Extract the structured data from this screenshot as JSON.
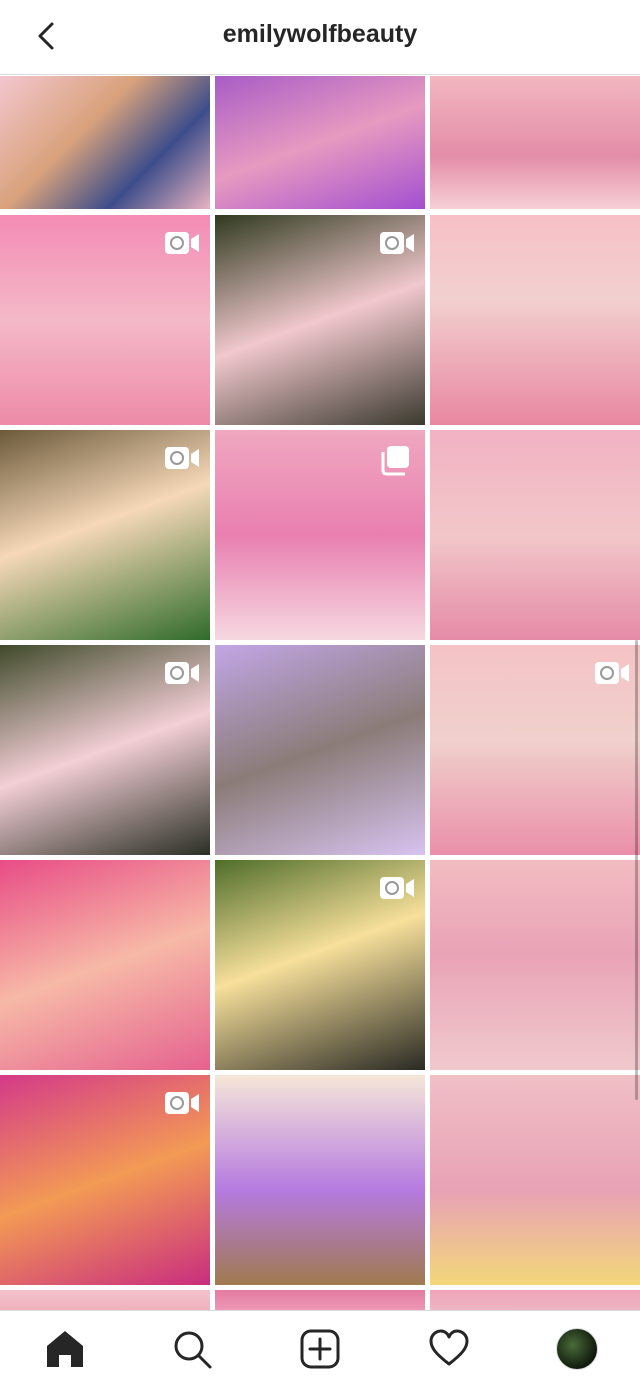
{
  "header": {
    "username": "emilywolfbeauty",
    "back_icon": "chevron-left-icon"
  },
  "grid": {
    "posts": [
      {
        "name": "post-makeup-flatlay",
        "bg": "linear-gradient(135deg,#f3c6cf,#d9a27c 40%,#3d4d8a 70%,#e9b3c2)",
        "badge": "none"
      },
      {
        "name": "post-puppy-pajamas",
        "bg": "linear-gradient(160deg,#a85cc6,#e79ac0 50%,#a34fd1)",
        "badge": "none"
      },
      {
        "name": "post-purple-lips",
        "bg": "linear-gradient(180deg,#f2b7c0,#e48da8 60%,#f7d0d6)",
        "badge": "none"
      },
      {
        "name": "post-pencil-mustache",
        "bg": "linear-gradient(180deg,#f48bb4,#f4b9c8 50%,#ee8aa8)",
        "badge": "video"
      },
      {
        "name": "post-axolotl-plants",
        "bg": "linear-gradient(160deg,#2f3a1f,#f1c8cd 50%,#3b3a2f)",
        "badge": "video"
      },
      {
        "name": "post-cupcake-lips",
        "bg": "linear-gradient(180deg,#f7c0c6,#f2d0cf 40%,#e987a1)",
        "badge": "none"
      },
      {
        "name": "post-axolotl-tophat",
        "bg": "linear-gradient(160deg,#6b5a3a,#f6d8b8 45%,#2f6b2a)",
        "badge": "video"
      },
      {
        "name": "post-pink-hair-back",
        "bg": "linear-gradient(180deg,#f0a8c0,#e97fb0 50%,#f6d8e0)",
        "badge": "carousel"
      },
      {
        "name": "post-popart-lips",
        "bg": "linear-gradient(180deg,#f2b2c3,#f2c7c9 50%,#e58ba7)",
        "badge": "none"
      },
      {
        "name": "post-axolotl-bowtie",
        "bg": "linear-gradient(160deg,#3f4a2a,#f3cfd6 50%,#2a2f24)",
        "badge": "video"
      },
      {
        "name": "post-dog-blanket",
        "bg": "linear-gradient(160deg,#c2a6e6,#8b7c78 50%,#d7c3f0)",
        "badge": "none"
      },
      {
        "name": "post-gloss-lips",
        "bg": "linear-gradient(180deg,#f4c2c5,#f0d1cc 45%,#ea8fa9)",
        "badge": "video"
      },
      {
        "name": "post-pink-portrait",
        "bg": "linear-gradient(160deg,#e84c86,#f7b9a7 50%,#e5628f)",
        "badge": "none"
      },
      {
        "name": "post-axolotl-yellow",
        "bg": "linear-gradient(160deg,#4f6d2a,#f7e09b 45%,#2a2a24)",
        "badge": "video"
      },
      {
        "name": "post-biden-harris-lips",
        "bg": "linear-gradient(180deg,#f3bcc2,#e9a3b6 45%,#f0c9cd)",
        "badge": "none"
      },
      {
        "name": "post-serum-glitter",
        "bg": "linear-gradient(160deg,#d43a89,#f39a55 50%,#c92d7f)",
        "badge": "video"
      },
      {
        "name": "post-dog-purple-wig",
        "bg": "linear-gradient(180deg,#f6e7d8,#b57ae0 55%,#a07a4f)",
        "badge": "none"
      },
      {
        "name": "post-tape-lips",
        "bg": "linear-gradient(180deg,#f0bfc6,#e8a2b5 55%,#f2d77a)",
        "badge": "none"
      },
      {
        "name": "post-partial-1",
        "bg": "linear-gradient(180deg,#f4c3cd,#f0b1be)",
        "badge": "none"
      },
      {
        "name": "post-partial-2",
        "bg": "linear-gradient(180deg,#e37aa0,#ee98b6)",
        "badge": "none"
      },
      {
        "name": "post-partial-3",
        "bg": "linear-gradient(180deg,#f0a3b9,#eeb6c5)",
        "badge": "none"
      }
    ]
  },
  "tabbar": {
    "items": [
      {
        "name": "tab-home",
        "icon": "home-icon"
      },
      {
        "name": "tab-search",
        "icon": "search-icon"
      },
      {
        "name": "tab-create",
        "icon": "add-post-icon"
      },
      {
        "name": "tab-activity",
        "icon": "heart-icon"
      },
      {
        "name": "tab-profile",
        "icon": "avatar"
      }
    ]
  }
}
